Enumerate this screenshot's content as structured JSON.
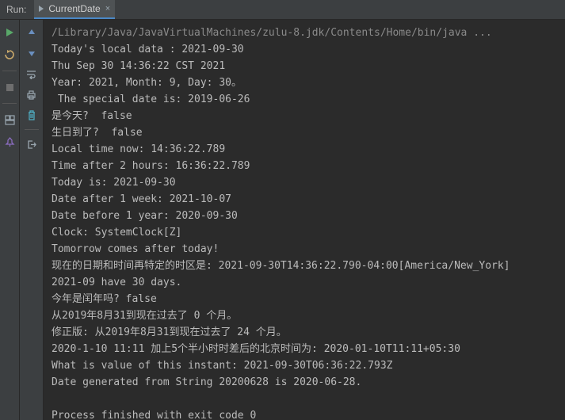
{
  "header": {
    "run_label": "Run:",
    "tab_label": "CurrentDate",
    "tab_close": "×"
  },
  "icons": {
    "left": [
      "run-icon",
      "rerun-icon",
      "stop-icon",
      "layout-icon",
      "pin-icon"
    ],
    "right": [
      "up-icon",
      "down-icon",
      "wrap-icon",
      "print-icon",
      "trash-icon",
      "exit-icon"
    ]
  },
  "console": {
    "command": "/Library/Java/JavaVirtualMachines/zulu-8.jdk/Contents/Home/bin/java ...",
    "lines": [
      "Today's local data : 2021-09-30",
      "Thu Sep 30 14:36:22 CST 2021",
      "Year: 2021, Month: 9, Day: 30。",
      " The special date is: 2019-06-26",
      "是今天?  false",
      "生日到了?  false",
      "Local time now: 14:36:22.789",
      "Time after 2 hours: 16:36:22.789",
      "Today is: 2021-09-30",
      "Date after 1 week: 2021-10-07",
      "Date before 1 year: 2020-09-30",
      "Clock: SystemClock[Z]",
      "Tomorrow comes after today!",
      "现在的日期和时间再特定的时区是: 2021-09-30T14:36:22.790-04:00[America/New_York]",
      "2021-09 have 30 days.",
      "今年是闰年吗? false",
      "从2019年8月31到现在过去了 0 个月。",
      "修正版: 从2019年8月31到现在过去了 24 个月。",
      "2020-1-10 11:11 加上5个半小时时差后的北京时间为: 2020-01-10T11:11+05:30",
      "What is value of this instant: 2021-09-30T06:36:22.793Z",
      "Date generated from String 20200628 is 2020-06-28.",
      "",
      "Process finished with exit code 0"
    ]
  }
}
